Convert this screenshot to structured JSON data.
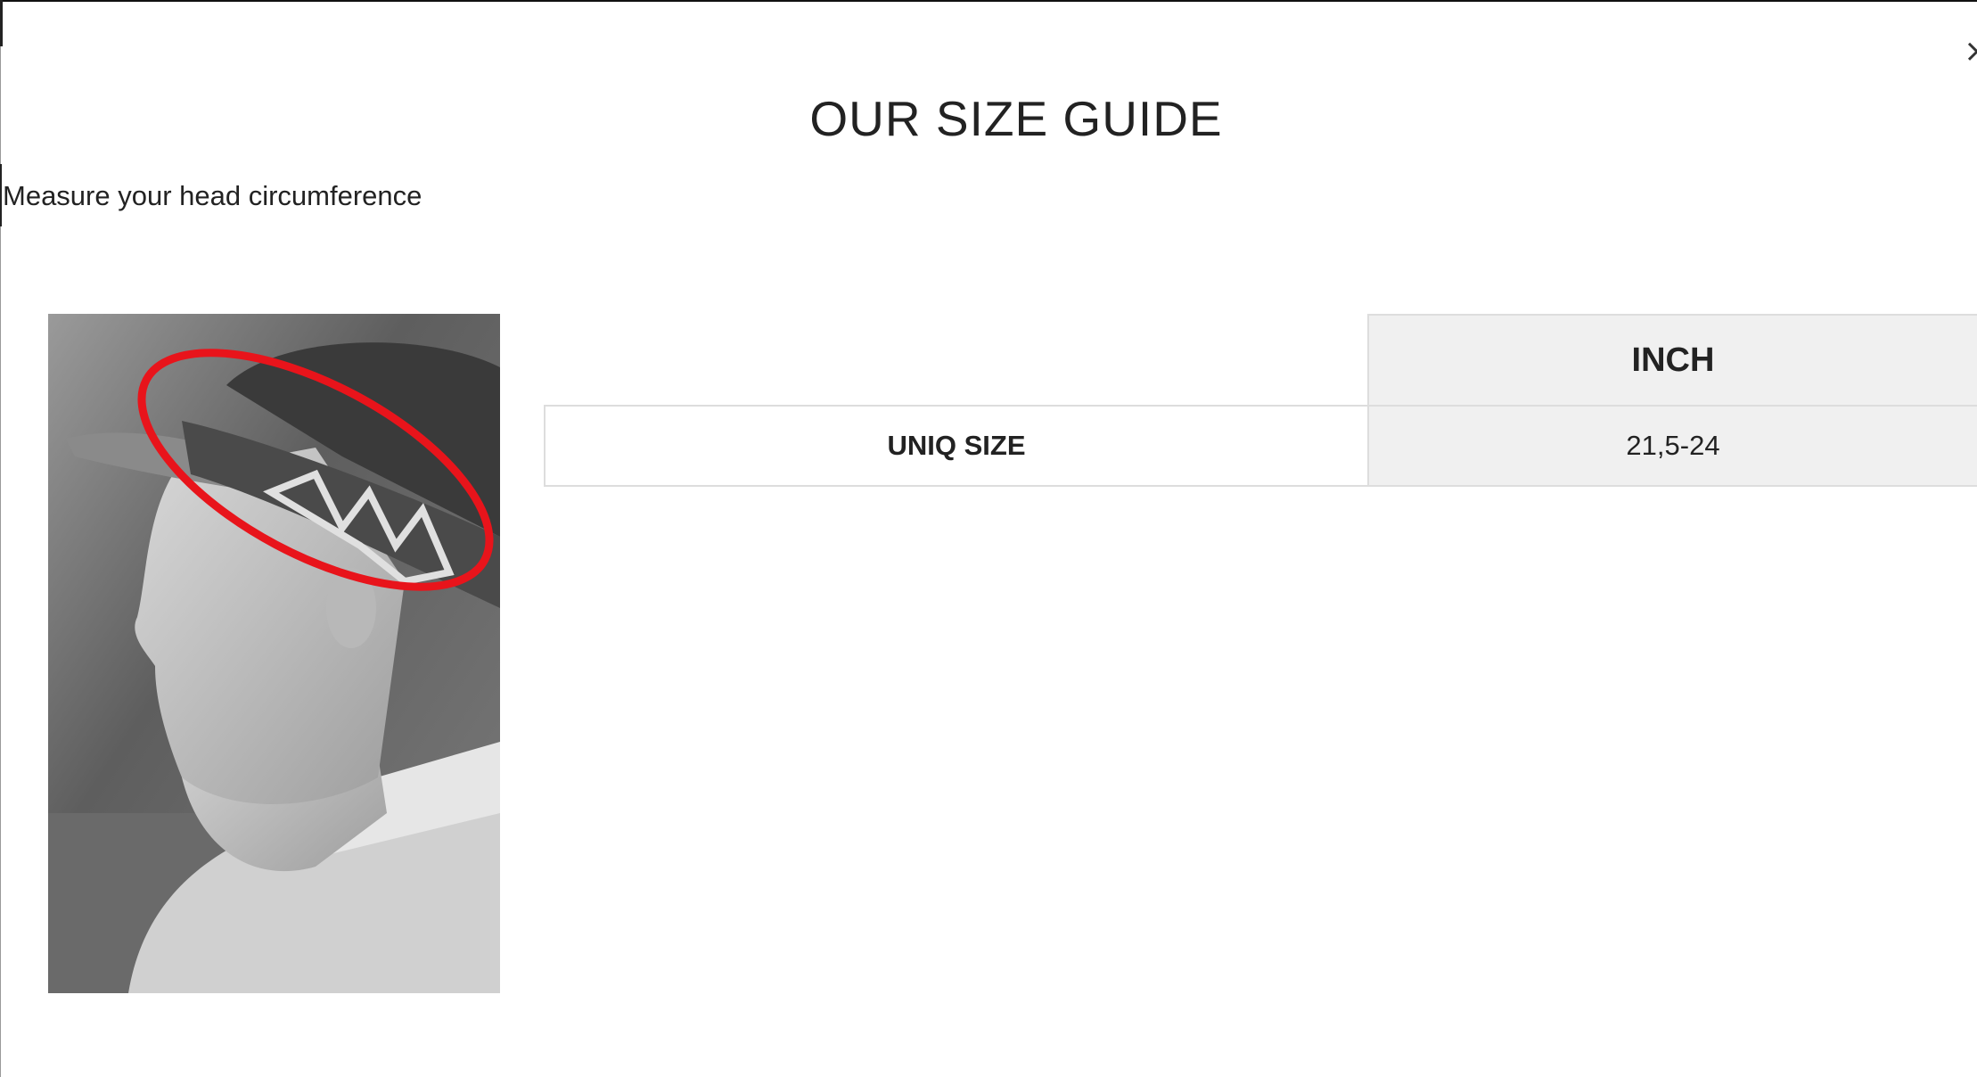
{
  "modal": {
    "title": "OUR SIZE GUIDE",
    "close_icon": "close-icon",
    "close_glyph": "×"
  },
  "intro": {
    "text": "Measure your head circumference"
  },
  "image": {
    "subject": "man-wearing-visor-with-red-measuring-band",
    "accent_color": "#e8141b"
  },
  "size_table": {
    "column_header": "INCH",
    "rows": [
      {
        "label": "UNIQ SIZE",
        "value": "21,5-24"
      }
    ]
  }
}
